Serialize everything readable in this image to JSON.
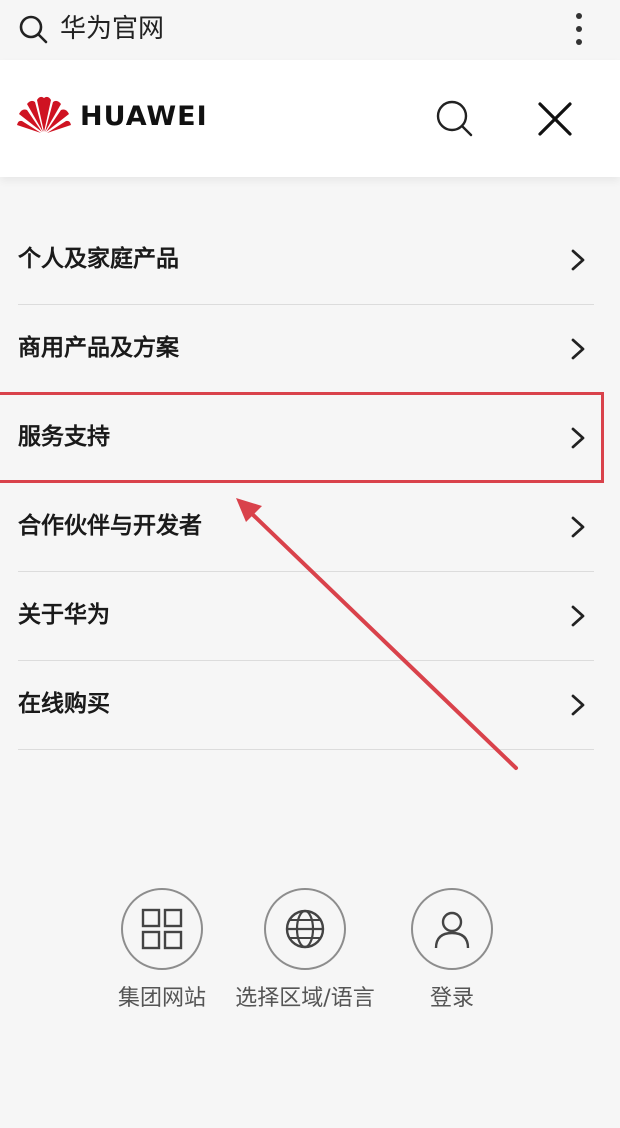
{
  "topbar": {
    "search_text": "华为官网"
  },
  "header": {
    "brand": "HUAWEI"
  },
  "menu": {
    "items": [
      {
        "label": "个人及家庭产品"
      },
      {
        "label": "商用产品及方案"
      },
      {
        "label": "服务支持"
      },
      {
        "label": "合作伙伴与开发者"
      },
      {
        "label": "关于华为"
      },
      {
        "label": "在线购买"
      }
    ]
  },
  "quick_links": [
    {
      "label": "集团网站",
      "icon": "grid-icon"
    },
    {
      "label": "选择区域/语言",
      "icon": "globe-icon"
    },
    {
      "label": "登录",
      "icon": "user-icon"
    }
  ],
  "colors": {
    "accent_red": "#d9424b",
    "logo_red": "#cf1322"
  }
}
